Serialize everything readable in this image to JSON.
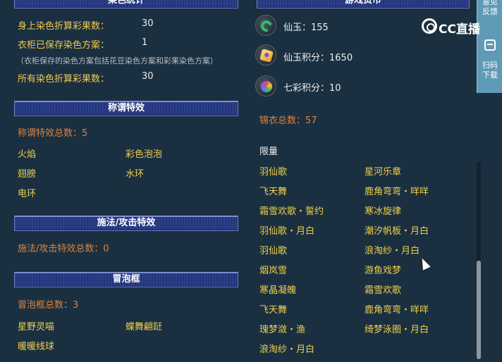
{
  "left": {
    "top_header": "染色统计",
    "dye_rows": [
      {
        "label": "身上染色折算彩果数：",
        "value": "30"
      },
      {
        "label": "衣柜已保存染色方案：",
        "value": "1"
      }
    ],
    "dye_note": "（衣柜保存的染色方案包括花豆染色方案和彩果染色方案）",
    "dye_total": {
      "label": "所有染色折算彩果数：",
      "value": "30"
    },
    "title_header": "称谓特效",
    "title_total": "称谓特效总数：5",
    "title_effects": [
      "火焰",
      "彩色泡泡",
      "翅膀",
      "水环",
      "电环"
    ],
    "spell_header": "施法/攻击特效",
    "spell_total": "施法/攻击特效总数：0",
    "bubble_header": "冒泡框",
    "bubble_total": "冒泡框总数：3",
    "bubble_items": [
      "星野灵喵",
      "蝶舞翩跹",
      "暖暖线球"
    ]
  },
  "right": {
    "top_header": "游戏货币",
    "currencies": [
      {
        "icon": "jade-icon",
        "label": "仙玉：155"
      },
      {
        "icon": "jade-points-icon",
        "label": "仙玉积分：1650"
      },
      {
        "icon": "rainbow-points-icon",
        "label": "七彩积分：10"
      }
    ],
    "jinyi_total": "锦衣总数：57",
    "limited_label": "限量",
    "limited_items": [
      "羽仙歌",
      "星河乐章",
      "飞天舞",
      "鹿角弯弯・咩咩",
      "霜雪欢歌・誓约",
      "寒冰旋律",
      "羽仙歌・月白",
      "潮汐帆板・月白",
      "羽仙歌",
      "浪淘纱・月白",
      "烟岚雪",
      "游鱼戏梦",
      "寒晶凝魄",
      "霜雪欢歌",
      "飞天舞",
      "鹿角弯弯・咩咩",
      "瑰梦潋・渔",
      "绮梦泳圈・月白",
      "浪淘纱・月白"
    ]
  },
  "side_panel": {
    "feedback": "意见反馈",
    "scan": "扫码下载"
  },
  "watermark": "CC直播",
  "colors": {
    "background": "#1a3041",
    "gold_text": "#f2c94c",
    "orange_text": "#e0823c",
    "header_bar": "#2c3f8a",
    "side_panel": "#5f9ab6"
  }
}
